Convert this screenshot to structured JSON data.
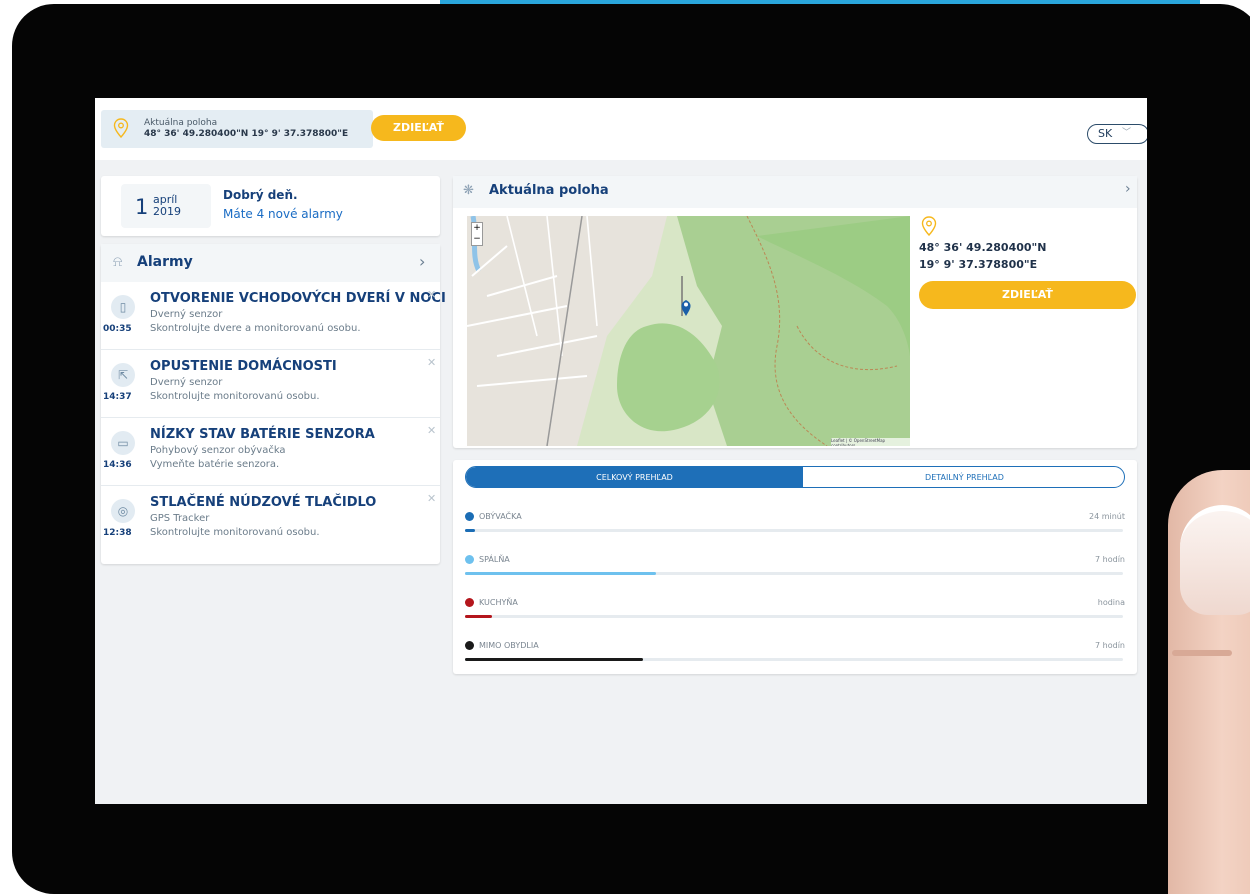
{
  "header": {
    "location_label": "Aktuálna poloha",
    "location_coords": "48° 36' 49.280400\"N 19° 9' 37.378800\"E",
    "share_label": "ZDIEĽAŤ",
    "language": "SK"
  },
  "greeting": {
    "day": "1",
    "month": "apríl",
    "year": "2019",
    "title": "Dobrý deň.",
    "subtitle": "Máte 4 nové alarmy"
  },
  "alarms": {
    "title": "Alarmy",
    "items": [
      {
        "title": "OTVORENIE VCHODOVÝCH DVERÍ V NOCI",
        "source": "Dverný senzor",
        "desc": "Skontrolujte dvere a monitorovanú osobu.",
        "time": "00:35",
        "icon": "door-icon"
      },
      {
        "title": "OPUSTENIE DOMÁCNOSTI",
        "source": "Dverný senzor",
        "desc": "Skontrolujte monitorovanú osobu.",
        "time": "14:37",
        "icon": "person-leaving-icon"
      },
      {
        "title": "NÍZKY STAV BATÉRIE SENZORA",
        "source": "Pohybový senzor obývačka",
        "desc": "Vymeňte batérie senzora.",
        "time": "14:36",
        "icon": "battery-icon"
      },
      {
        "title": "STLAČENÉ NÚDZOVÉ TLAČIDLO",
        "source": "GPS Tracker",
        "desc": "Skontrolujte monitorovanú osobu.",
        "time": "12:38",
        "icon": "emergency-button-icon"
      }
    ]
  },
  "location": {
    "title": "Aktuálna poloha",
    "lat": "48° 36' 49.280400\"N",
    "lon": "19° 9' 37.378800\"E",
    "share_label": "ZDIEĽAŤ",
    "map_attribution": "Leaflet | © OpenStreetMap contributors"
  },
  "overview": {
    "tab_total": "CELKOVÝ PREHĽAD",
    "tab_detail": "DETAILNÝ PREHĽAD",
    "rooms": [
      {
        "name": "OBÝVAČKA",
        "value": "24 minút",
        "fraction": 0.015,
        "color": "#1b6db5"
      },
      {
        "name": "SPÁLŇA",
        "value": "7 hodín",
        "fraction": 0.29,
        "color": "#6ec1ee"
      },
      {
        "name": "KUCHYŇA",
        "value": "hodina",
        "fraction": 0.041,
        "color": "#b4161c"
      },
      {
        "name": "MIMO OBYDLIA",
        "value": "7 hodín",
        "fraction": 0.27,
        "color": "#1a1a1a"
      }
    ]
  },
  "colors": {
    "accent": "#f6b81d",
    "primary": "#16407a",
    "tab_active": "#1e6fb8"
  }
}
